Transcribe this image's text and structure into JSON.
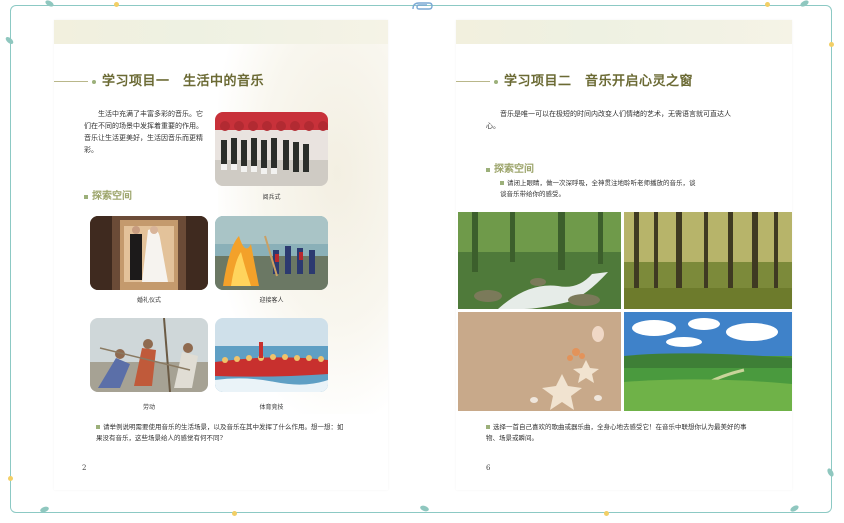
{
  "left_page": {
    "heading": "学习项目一　生活中的音乐",
    "intro": "生活中充满了丰富多彩的音乐。它们在不同的场景中发挥着重要的作用。音乐让生活更美好，生活因音乐而更精彩。",
    "explore_title": "探索空间",
    "captions": [
      "阅兵式",
      "婚礼仪式",
      "迎接客人",
      "劳动",
      "体育竞技"
    ],
    "question": "请举例说明需要使用音乐的生活场景，以及音乐在其中发挥了什么作用。想一想：如果没有音乐，这些场景给人的感觉有何不同?",
    "page_number": "2"
  },
  "right_page": {
    "heading": "学习项目二　音乐开启心灵之窗",
    "intro": "音乐是唯一可以在极短的时间内改变人们情绪的艺术，无需语言就可直达人心。",
    "explore_title": "探索空间",
    "instruction": "请闭上眼睛，做一次深呼吸，全神贯注地聆听老师播放的音乐，谈谈音乐带给你的感受。",
    "task": "选择一首自己喜欢的歌曲或器乐曲，全身心地去感受它！在音乐中联想你认为最美好的事物、场景或瞬间。",
    "page_number": "6"
  },
  "colors": {
    "heading": "#6b6a34",
    "accent": "#9cb07a",
    "frame": "#8cc9c4"
  }
}
